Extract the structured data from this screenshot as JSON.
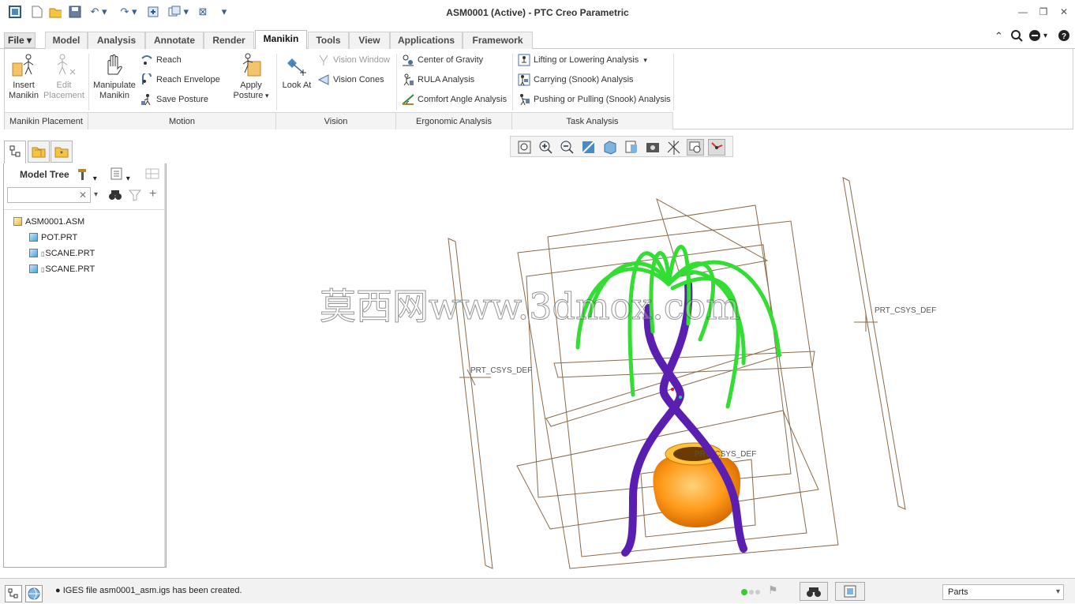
{
  "window": {
    "title": "ASM0001 (Active) - PTC Creo Parametric"
  },
  "quick_access": [
    "window-icon",
    "new-icon",
    "open-icon",
    "save-icon",
    "undo-icon",
    "redo-icon",
    "regenerate-icon",
    "switch-windows-icon",
    "close-window-icon",
    "customize-icon"
  ],
  "tabs": {
    "file": "File",
    "items": [
      "Model",
      "Analysis",
      "Annotate",
      "Render",
      "Manikin",
      "Tools",
      "View",
      "Applications",
      "Framework"
    ],
    "active": "Manikin"
  },
  "ribbon": {
    "placement": {
      "insert": "Insert\nManikin",
      "edit": "Edit\nPlacement",
      "label": "Manikin Placement"
    },
    "motion": {
      "manipulate": "Manipulate\nManikin",
      "reach": "Reach",
      "reach_envelope": "Reach Envelope",
      "save_posture": "Save Posture",
      "apply_posture": "Apply\nPosture",
      "label": "Motion"
    },
    "vision": {
      "look_at": "Look At",
      "vision_window": "Vision Window",
      "vision_cones": "Vision Cones",
      "label": "Vision"
    },
    "ergonomic": {
      "cog": "Center of Gravity",
      "rula": "RULA Analysis",
      "comfort": "Comfort Angle Analysis",
      "label": "Ergonomic Analysis"
    },
    "task": {
      "lifting": "Lifting or Lowering Analysis",
      "carrying": "Carrying (Snook) Analysis",
      "pushing": "Pushing or Pulling (Snook) Analysis",
      "label": "Task Analysis"
    }
  },
  "model_tree": {
    "title": "Model Tree",
    "search_value": "",
    "items": [
      "ASM0001.ASM",
      "POT.PRT",
      "SCANE.PRT",
      "SCANE.PRT"
    ]
  },
  "viewport": {
    "csys_labels": [
      "PRT_CSYS_DEF",
      "PRT_CSYS_DEF",
      "PRT_CSYS_DEF"
    ],
    "watermark": "莫西网www.3dmox.com",
    "colors": {
      "leaves": "#33dd33",
      "trunk": "#5a1fb0",
      "pot": "#ff9a1a",
      "datum": "#8a6a4a"
    }
  },
  "status": {
    "message": "IGES file asm0001_asm.igs has been created.",
    "filter_value": "Parts"
  }
}
